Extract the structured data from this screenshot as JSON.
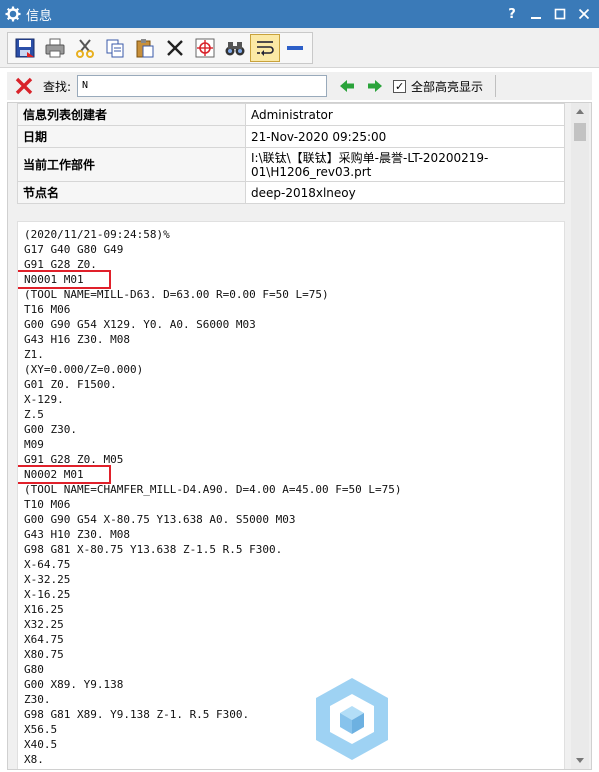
{
  "window": {
    "title": "信息",
    "icon": "gear-icon",
    "controls": [
      "?",
      "minimize",
      "maximize",
      "close"
    ],
    "help_label": "?"
  },
  "toolbar": {
    "buttons": [
      "save-icon",
      "print-icon",
      "cut-icon",
      "copy-icon",
      "paste-icon",
      "delete-icon",
      "crosshair-icon",
      "binoculars-icon",
      "wrap-text-icon",
      "collapse-icon"
    ],
    "active_button": "wrap-text-icon"
  },
  "find": {
    "label": "查找:",
    "value": "N",
    "highlight_all_label": "全部高亮显示",
    "highlight_all_checked": true
  },
  "info_table": [
    {
      "key": "信息列表创建者",
      "value": "Administrator"
    },
    {
      "key": "日期",
      "value": "21-Nov-2020 09:25:00"
    },
    {
      "key": "当前工作部件",
      "value_line1": "I:\\联钛\\【联钛】采购单-晨誉-LT-20200219-",
      "value_line2": "01\\H1206_rev03.prt"
    },
    {
      "key": "节点名",
      "value": "deep-2018xlneoy"
    }
  ],
  "code_lines": [
    "(2020/11/21-09:24:58)%",
    "G17 G40 G80 G49",
    "G91 G28 Z0.",
    "N0001 M01",
    "(TOOL NAME=MILL-D63. D=63.00 R=0.00 F=50 L=75)",
    "T16 M06",
    "G00 G90 G54 X129. Y0. A0. S6000 M03",
    "G43 H16 Z30. M08",
    "Z1.",
    "(XY=0.000/Z=0.000)",
    "G01 Z0. F1500.",
    "X-129.",
    "Z.5",
    "G00 Z30.",
    "M09",
    "G91 G28 Z0. M05",
    "N0002 M01",
    "(TOOL NAME=CHAMFER_MILL-D4.A90. D=4.00 A=45.00 F=50 L=75)",
    "T10 M06",
    "G00 G90 G54 X-80.75 Y13.638 A0. S5000 M03",
    "G43 H10 Z30. M08",
    "G98 G81 X-80.75 Y13.638 Z-1.5 R.5 F300.",
    "X-64.75",
    "X-32.25",
    "X-16.25",
    "X16.25",
    "X32.25",
    "X64.75",
    "X80.75",
    "G80",
    "G00 X89. Y9.138",
    "Z30.",
    "G98 G81 X89. Y9.138 Z-1. R.5 F300.",
    "X56.5",
    "X40.5",
    "X8."
  ],
  "highlighted_lines": [
    3,
    16
  ],
  "colors": {
    "titlebar": "#3a7ab8",
    "highlight_border": "#e0202a",
    "arrow_green": "#2aa33a",
    "x_red": "#d9232a"
  }
}
